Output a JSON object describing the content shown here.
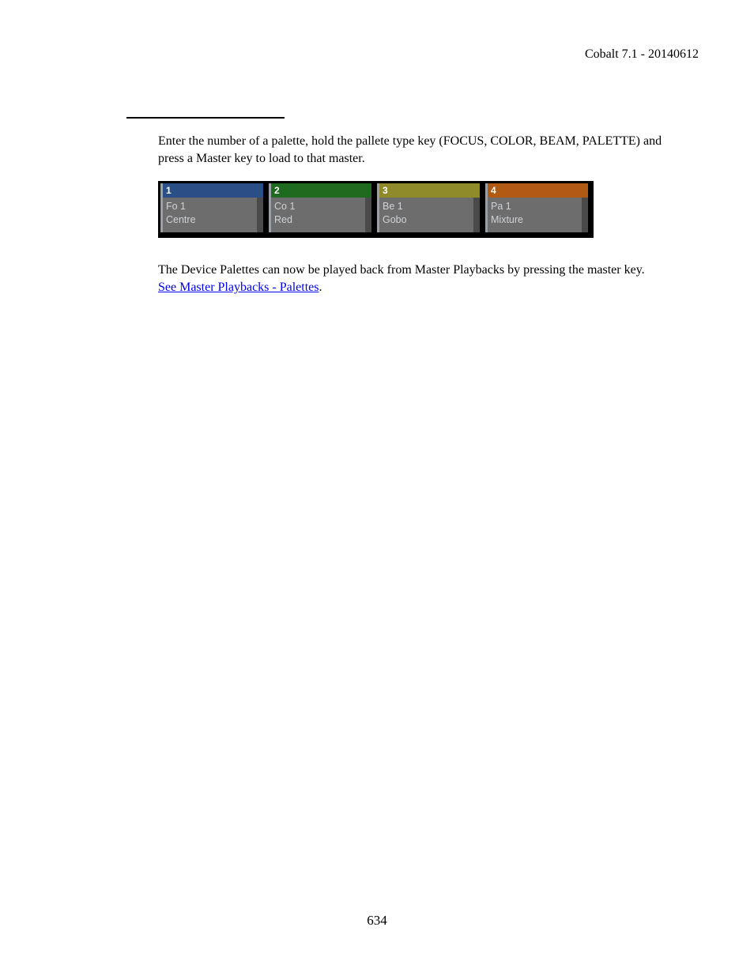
{
  "header": {
    "product_version": "Cobalt 7.1 - 20140612"
  },
  "body": {
    "para1": "Enter the number of a palette, hold the pallete type key (FOCUS, COLOR, BEAM, PALETTE) and press a Master key to load to that master.",
    "para2_pre": "The Device Palettes can now be played back from Master Playbacks by pressing the master key. ",
    "link_text": "See Master Playbacks - Palettes",
    "para2_post": "."
  },
  "palettes": [
    {
      "num": "1",
      "line1": "Fo 1",
      "line2": "Centre",
      "color": "c-blue"
    },
    {
      "num": "2",
      "line1": "Co 1",
      "line2": "Red",
      "color": "c-green"
    },
    {
      "num": "3",
      "line1": "Be 1",
      "line2": "Gobo",
      "color": "c-olive"
    },
    {
      "num": "4",
      "line1": "Pa 1",
      "line2": "Mixture",
      "color": "c-orange"
    }
  ],
  "page_number": "634"
}
